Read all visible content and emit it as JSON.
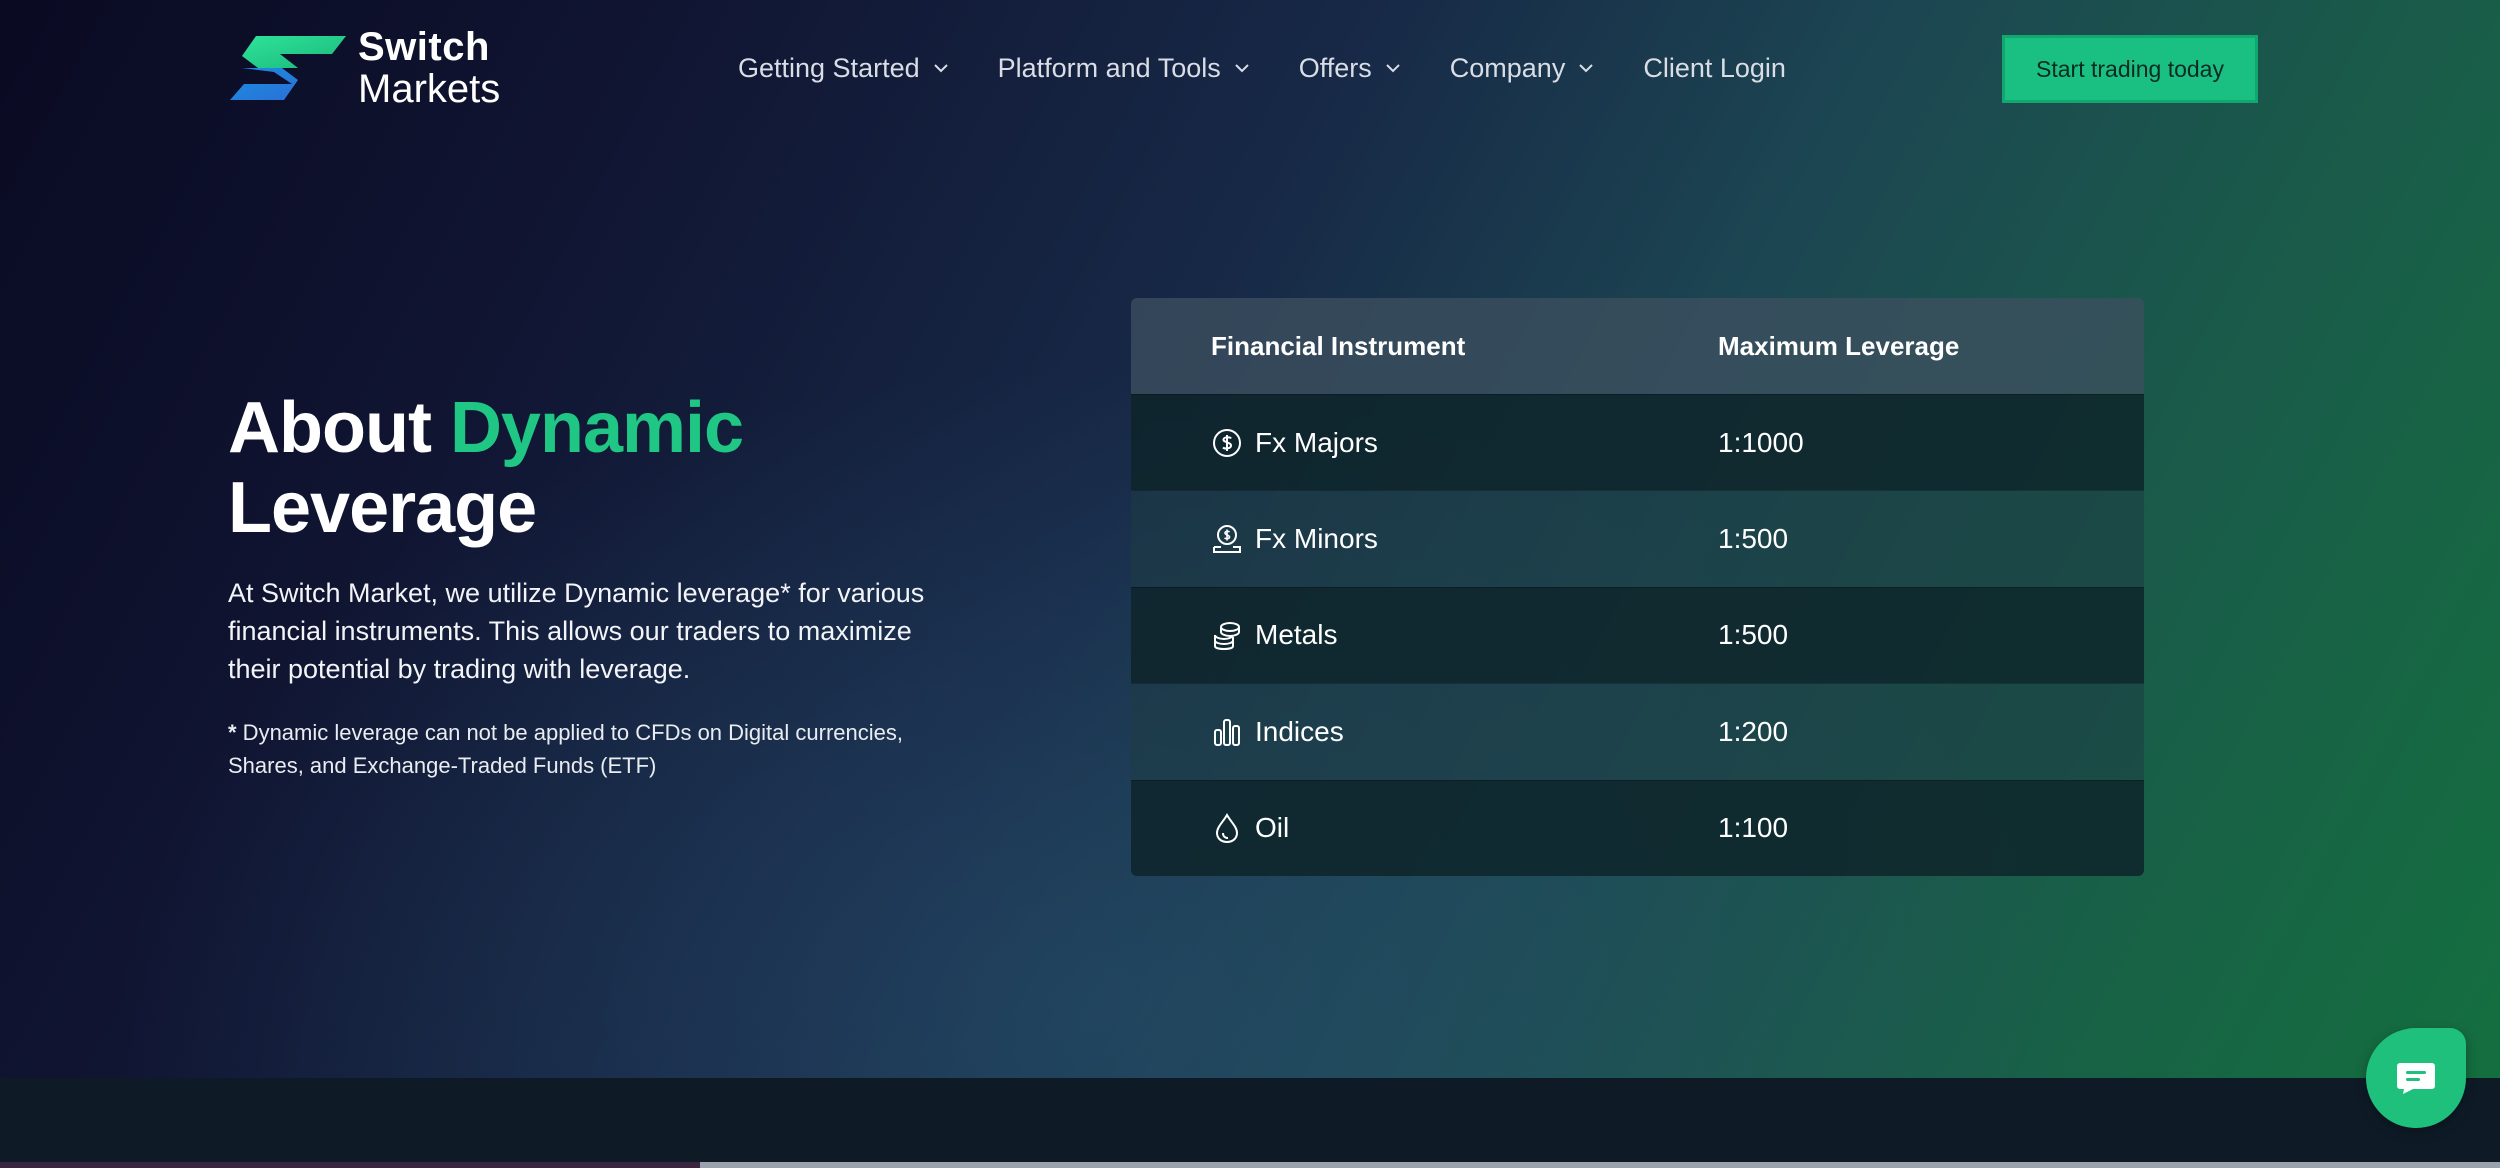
{
  "brand": {
    "name_line1": "Switch",
    "name_line2": "Markets"
  },
  "nav": {
    "items": [
      {
        "label": "Getting Started"
      },
      {
        "label": "Platform and Tools"
      },
      {
        "label": "Offers"
      },
      {
        "label": "Company"
      }
    ],
    "login_label": "Client Login",
    "cta_label": "Start trading today"
  },
  "hero": {
    "title_part1": "About",
    "title_accent": "Dynamic",
    "title_part2": "Leverage",
    "description": "At Switch Market, we utilize Dynamic leverage* for various financial instruments. This allows our traders to maximize their potential by trading with leverage.",
    "note_star": "*",
    "note_text": " Dynamic leverage can not be applied to CFDs on Digital currencies, Shares, and Exchange-Traded Funds (ETF)"
  },
  "table": {
    "headers": [
      "Financial Instrument",
      "Maximum Leverage"
    ],
    "rows": [
      {
        "instrument": "Fx Majors",
        "leverage": "1:1000",
        "icon": "dollar-coin-icon"
      },
      {
        "instrument": "Fx Minors",
        "leverage": "1:500",
        "icon": "coin-hand-icon"
      },
      {
        "instrument": "Metals",
        "leverage": "1:500",
        "icon": "coin-stack-icon"
      },
      {
        "instrument": "Indices",
        "leverage": "1:200",
        "icon": "bar-chart-icon"
      },
      {
        "instrument": "Oil",
        "leverage": "1:100",
        "icon": "oil-drop-icon"
      }
    ]
  },
  "colors": {
    "accent": "#20c784",
    "cta_bg": "#19c081",
    "chat_bg": "#1fc07c"
  }
}
